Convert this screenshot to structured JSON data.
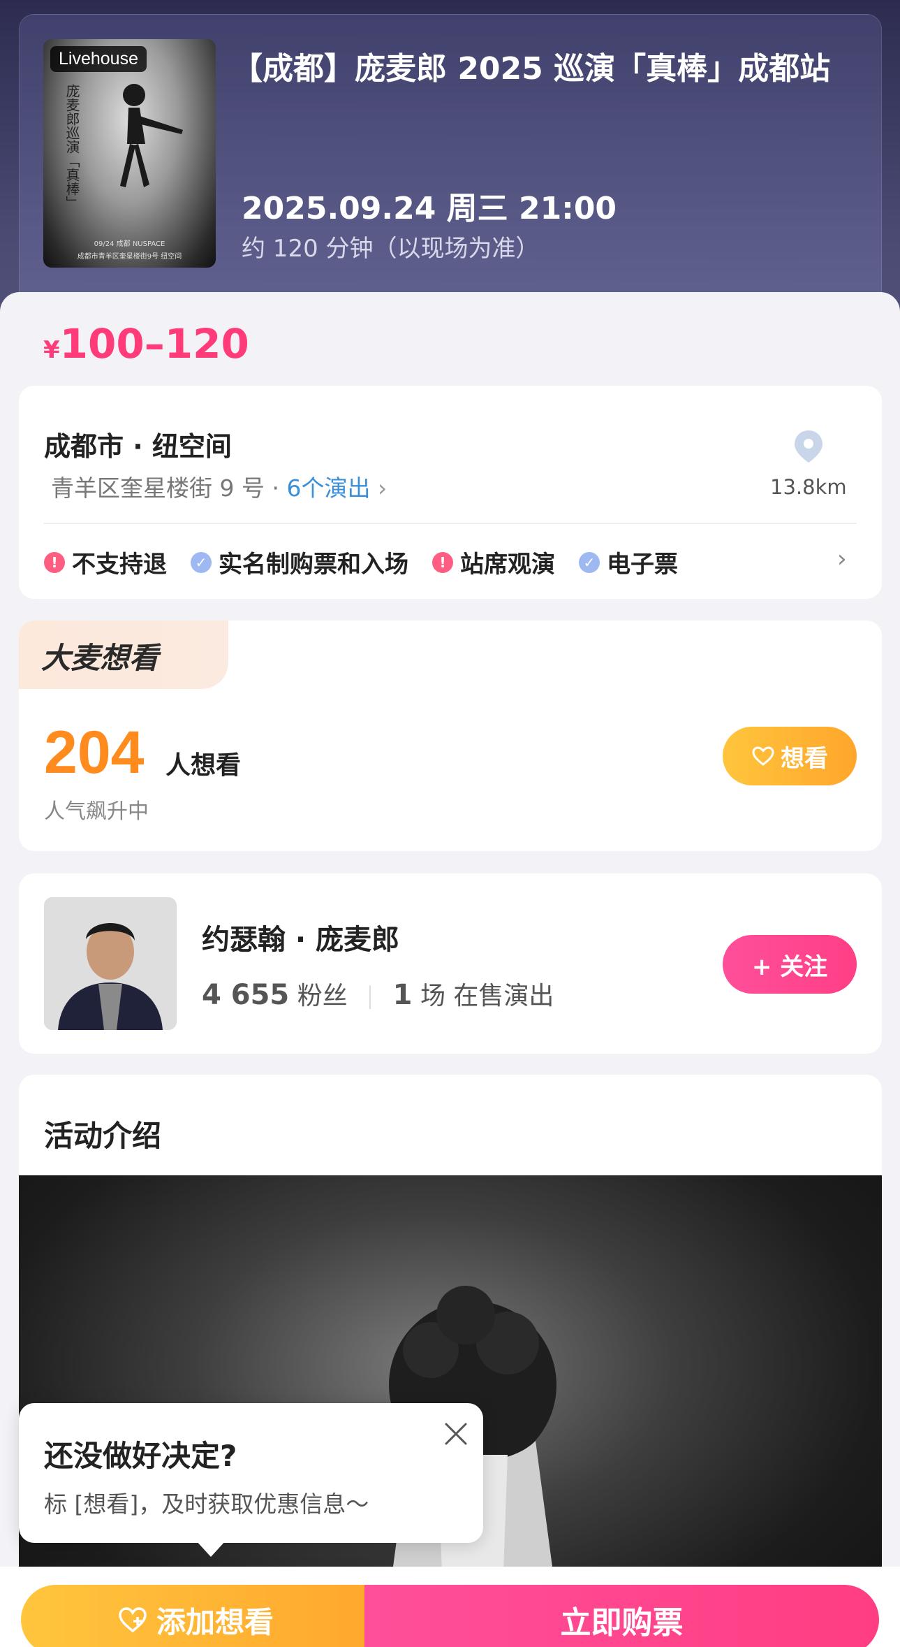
{
  "event": {
    "poster_tag": "Livehouse",
    "poster_vertical_text": "庞麦郎巡演「真棒」",
    "poster_date_text": "09/24 成都 NUSPACE",
    "poster_addr_text": "成都市青羊区奎星楼街9号 纽空间",
    "title": "【成都】庞麦郎 2025 巡演「真棒」成都站",
    "datetime": "2025.09.24 周三 21:00",
    "duration": "约 120 分钟（以现场为准）"
  },
  "price": {
    "symbol": "¥",
    "range": "100–120"
  },
  "venue": {
    "name": "成都市 · 纽空间",
    "address": "青羊区奎星楼街 9 号 · ",
    "shows_link": "6个演出",
    "distance": "13.8km",
    "tags": [
      {
        "label": "不支持退",
        "kind": "warn"
      },
      {
        "label": "实名制购票和入场",
        "kind": "ok"
      },
      {
        "label": "站席观演",
        "kind": "warn"
      },
      {
        "label": "电子票",
        "kind": "ok"
      }
    ]
  },
  "want": {
    "badge": "大麦想看",
    "count": "204",
    "unit": "人想看",
    "sub": "人气飙升中",
    "button": "想看"
  },
  "artist": {
    "name": "约瑟翰 · 庞麦郎",
    "fans_count": "4 655",
    "fans_label": "粉丝",
    "shows_count": "1",
    "shows_label": "场 在售演出",
    "follow_button": "+ 关注"
  },
  "intro": {
    "title": "活动介绍"
  },
  "tooltip": {
    "title": "还没做好决定?",
    "text": "标 [想看]，及时获取优惠信息～"
  },
  "bottom": {
    "add_want": "添加想看",
    "buy_now": "立即购票"
  },
  "colors": {
    "accent_pink": "#ff3c79",
    "accent_orange": "#ff8a1e",
    "link_blue": "#3a8fd8"
  }
}
